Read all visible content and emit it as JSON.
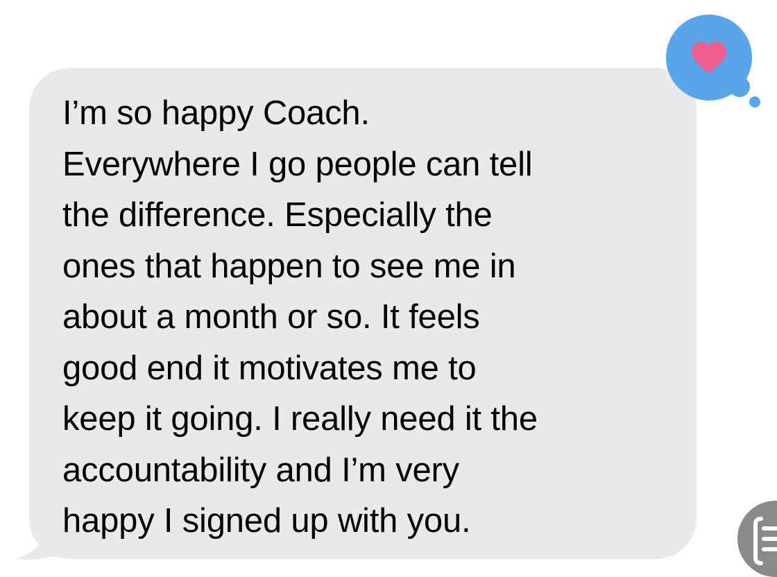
{
  "message": {
    "sender": "incoming",
    "lines": [
      "I’m so happy Coach.",
      "Everywhere I go people can tell",
      "the difference. Especially the",
      "ones that happen to see me in",
      "about a month or so. It feels",
      "good end it motivates me to",
      "keep it going. I really need it the",
      "accountability and I’m very",
      "happy I signed up with you."
    ],
    "bubble_color": "#e9e9eb",
    "text_color": "#000000"
  },
  "tapback": {
    "icon": "heart-icon",
    "bubble_color": "#5aa4ea",
    "heart_color": "#ec5f8f"
  },
  "side_control": {
    "icon": "list-icon",
    "color": "#8a8a8a"
  }
}
